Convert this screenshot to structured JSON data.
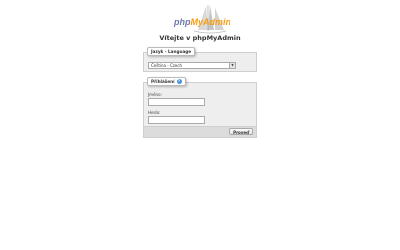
{
  "logo": {
    "text_php": "php",
    "text_myadmin": "MyAdmin"
  },
  "welcome_title": "Vítejte v phpMyAdmin",
  "language_panel": {
    "legend": "Jazyk - Language",
    "selected_language": "Čeština - Czech"
  },
  "login_panel": {
    "legend": "Přihlášení",
    "username_label": "Jméno:",
    "password_label": "Heslo:",
    "username_value": "",
    "password_value": "",
    "go_button": "Proveď"
  },
  "colors": {
    "php": "#6c78af",
    "myadmin": "#f89c0e",
    "panel_bg": "#eeeeee",
    "footer_bg": "#dcdcdc"
  }
}
